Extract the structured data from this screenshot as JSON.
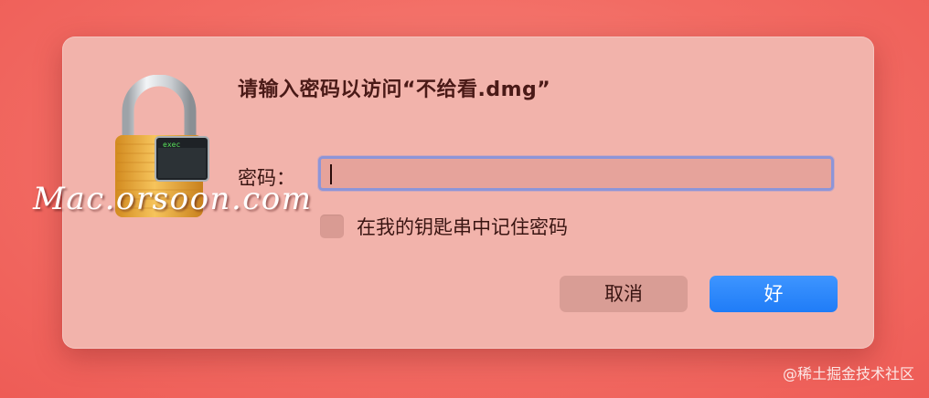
{
  "dialog": {
    "title": "请输入密码以访问“不给看.dmg”",
    "password_label": "密码：",
    "password_value": "",
    "remember_label": "在我的钥匙串中记住密码",
    "remember_checked": false,
    "cancel_label": "取消",
    "ok_label": "好",
    "icon_text": "exec"
  },
  "watermark": "Mac.orsoon.com",
  "credit": "@稀土掘金技术社区",
  "colors": {
    "accent": "#1f7cf7",
    "dialog_bg": "#f2b3ab",
    "focus_ring": "#8d95d8"
  }
}
